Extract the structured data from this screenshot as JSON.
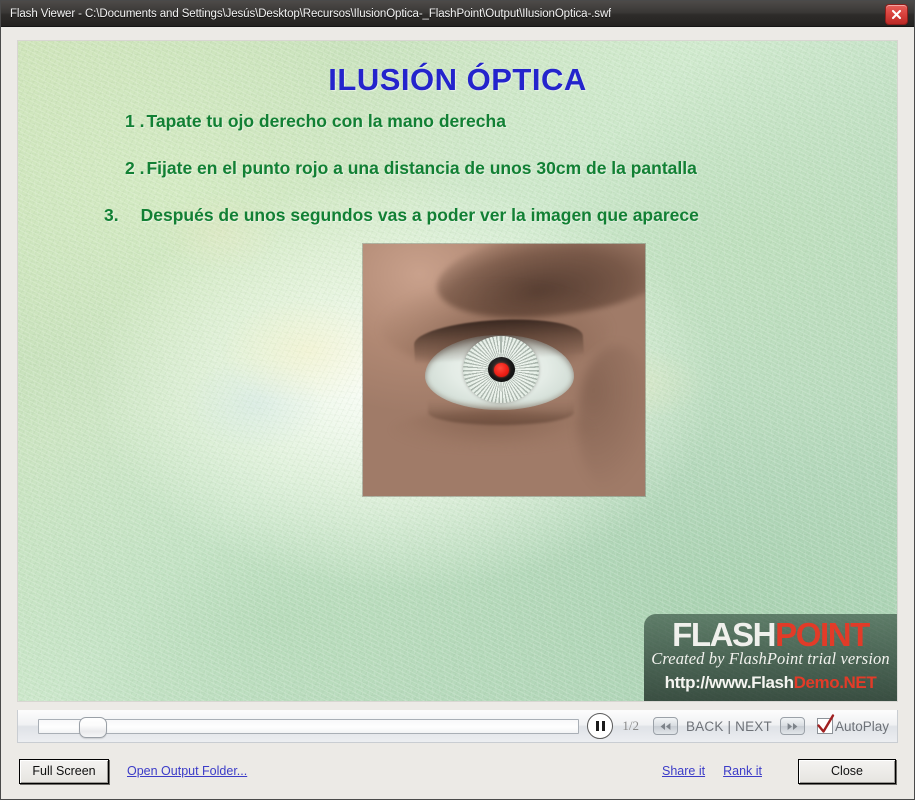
{
  "window": {
    "title": "Flash Viewer - C:\\Documents and Settings\\Jesús\\Desktop\\Recursos\\IlusionOptica-_FlashPoint\\Output\\IlusionOptica-.swf",
    "close_icon": "close-x-icon"
  },
  "slide": {
    "title": "ILUSIÓN ÓPTICA",
    "title_color": "#2424cc",
    "text_color": "#128034",
    "steps": [
      {
        "num": "1 .",
        "text": "Tapate tu ojo derecho con la mano derecha"
      },
      {
        "num": "2 .",
        "text": "Fijate en el punto rojo a una distancia de unos 30cm de la pantalla"
      },
      {
        "num": "3.",
        "text": "Después de unos segundos vas a poder ver la imagen que aparece"
      }
    ],
    "image_alt": "eye-with-red-dot-photo"
  },
  "watermark": {
    "logo_part1": "FLASH",
    "logo_part2": "POINT",
    "tagline": "Created by FlashPoint trial version",
    "url_part1": "http://www.Flash",
    "url_part2": "Demo.NET",
    "accent_color": "#e23b28"
  },
  "controls": {
    "pause_icon": "pause-icon",
    "page_counter": "1/2",
    "back_icon": "rewind-icon",
    "next_icon": "fast-forward-icon",
    "nav_label": "BACK | NEXT",
    "autoplay_label": "AutoPlay",
    "autoplay_checked": true,
    "seek_position_percent": 7.5
  },
  "toolbar": {
    "full_screen_label": "Full Screen",
    "open_output_folder_label": "Open Output Folder...",
    "share_label": "Share it",
    "rank_label": "Rank it",
    "close_label": "Close"
  }
}
